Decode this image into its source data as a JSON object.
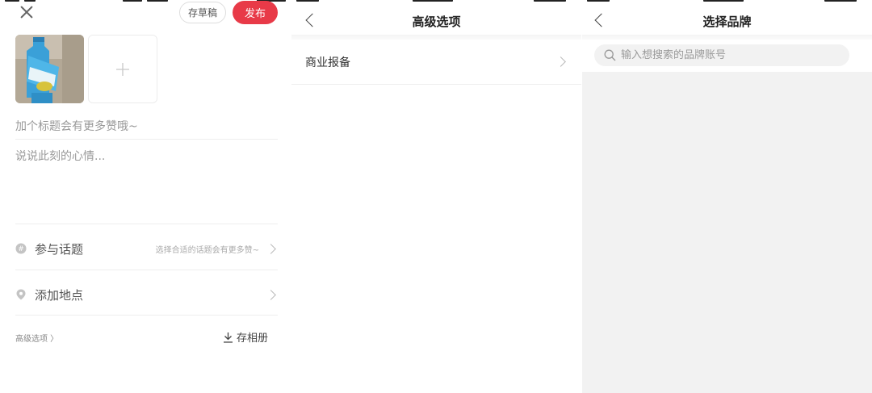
{
  "editor": {
    "draft_label": "存草稿",
    "publish_label": "发布",
    "title_placeholder": "加个标题会有更多赞哦~",
    "body_placeholder": "说说此刻的心情...",
    "topic": {
      "label": "参与话题",
      "hint": "选择合适的话题会有更多赞~"
    },
    "location": {
      "label": "添加地点"
    },
    "advanced_link": "高级选项 〉",
    "save_album_label": "存相册"
  },
  "advanced": {
    "title": "高级选项",
    "items": [
      {
        "label": "商业报备"
      }
    ]
  },
  "brand": {
    "title": "选择品牌",
    "search_placeholder": "输入想搜索的品牌账号"
  },
  "colors": {
    "accent": "#e83a48",
    "divider": "#eeeeee",
    "empty_bg": "#f2f2f2"
  },
  "icons": [
    "close-icon",
    "plus-icon",
    "topic-icon",
    "location-pin-icon",
    "chevron-right-icon",
    "download-icon",
    "back-arrow-icon",
    "search-icon"
  ]
}
